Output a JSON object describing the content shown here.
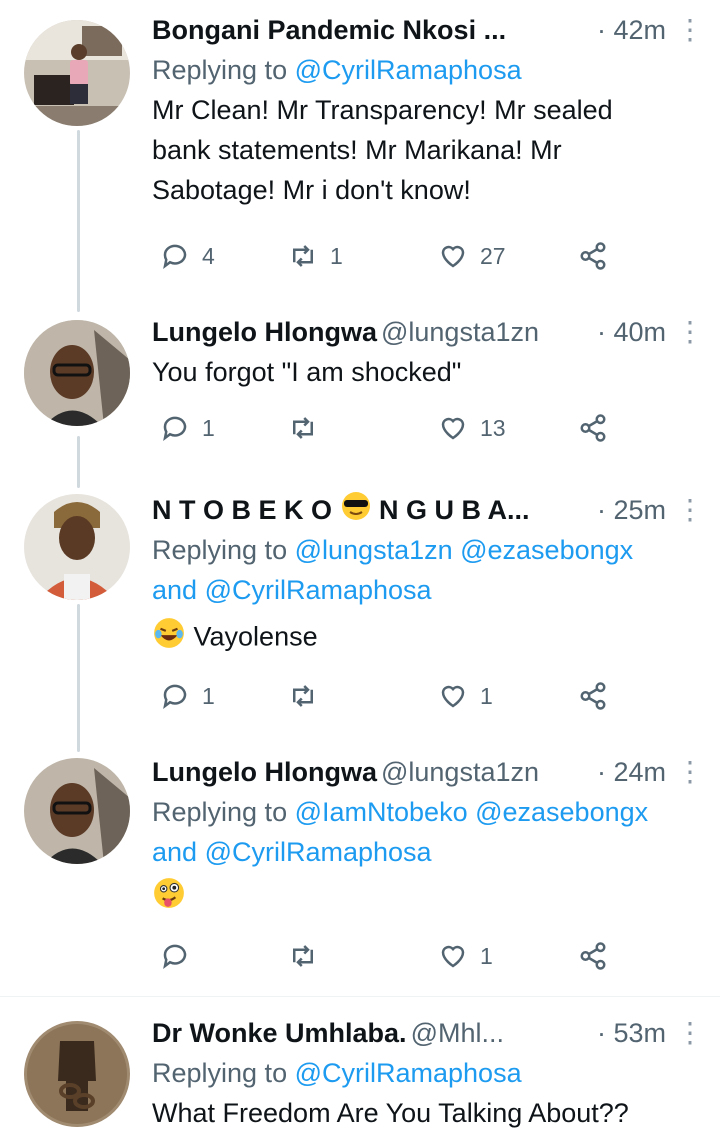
{
  "tweets": [
    {
      "name": "Bongani Pandemic Nkosi ...",
      "handle": "",
      "time": "· 42m",
      "reply_prefix": "Replying to",
      "reply_to": "@CyrilRamaphosa",
      "reply_to_2": "",
      "text_lines": [
        "Mr Clean! Mr Transparency! Mr sealed",
        "bank statements! Mr Marikana! Mr",
        "Sabotage! Mr i don't know!"
      ],
      "replies": "4",
      "retweets": "1",
      "likes": "27"
    },
    {
      "name": "Lungelo Hlongwa",
      "handle": "@lungsta1zn",
      "time": "· 40m",
      "text_lines": [
        "You forgot \"I am shocked\""
      ],
      "replies": "1",
      "retweets": "",
      "likes": "13"
    },
    {
      "name": "N T O B E K O",
      "name_after": "N G U B A...",
      "handle": "",
      "time": "· 25m",
      "reply_prefix": "Replying to",
      "reply_to": "@lungsta1zn @ezasebongx",
      "reply_and": "and",
      "reply_to_2": "@CyrilRamaphosa",
      "text": "Vayolense",
      "replies": "1",
      "retweets": "",
      "likes": "1"
    },
    {
      "name": "Lungelo Hlongwa",
      "handle": "@lungsta1zn",
      "time": "· 24m",
      "reply_prefix": "Replying to",
      "reply_to": "@IamNtobeko @ezasebongx",
      "reply_and": "and",
      "reply_to_2": "@CyrilRamaphosa",
      "replies": "",
      "retweets": "",
      "likes": "1"
    },
    {
      "name": "Dr Wonke Umhlaba.",
      "handle": "@Mhl...",
      "time": "· 53m",
      "reply_prefix": "Replying to",
      "reply_to": "@CyrilRamaphosa",
      "text": "What Freedom Are You Talking About??"
    }
  ],
  "colors": {
    "link": "#1d9bf0",
    "muted": "#536471",
    "thread_line": "#cfd9de"
  },
  "icons": [
    "reply-icon",
    "retweet-icon",
    "like-icon",
    "share-icon",
    "more-icon"
  ]
}
